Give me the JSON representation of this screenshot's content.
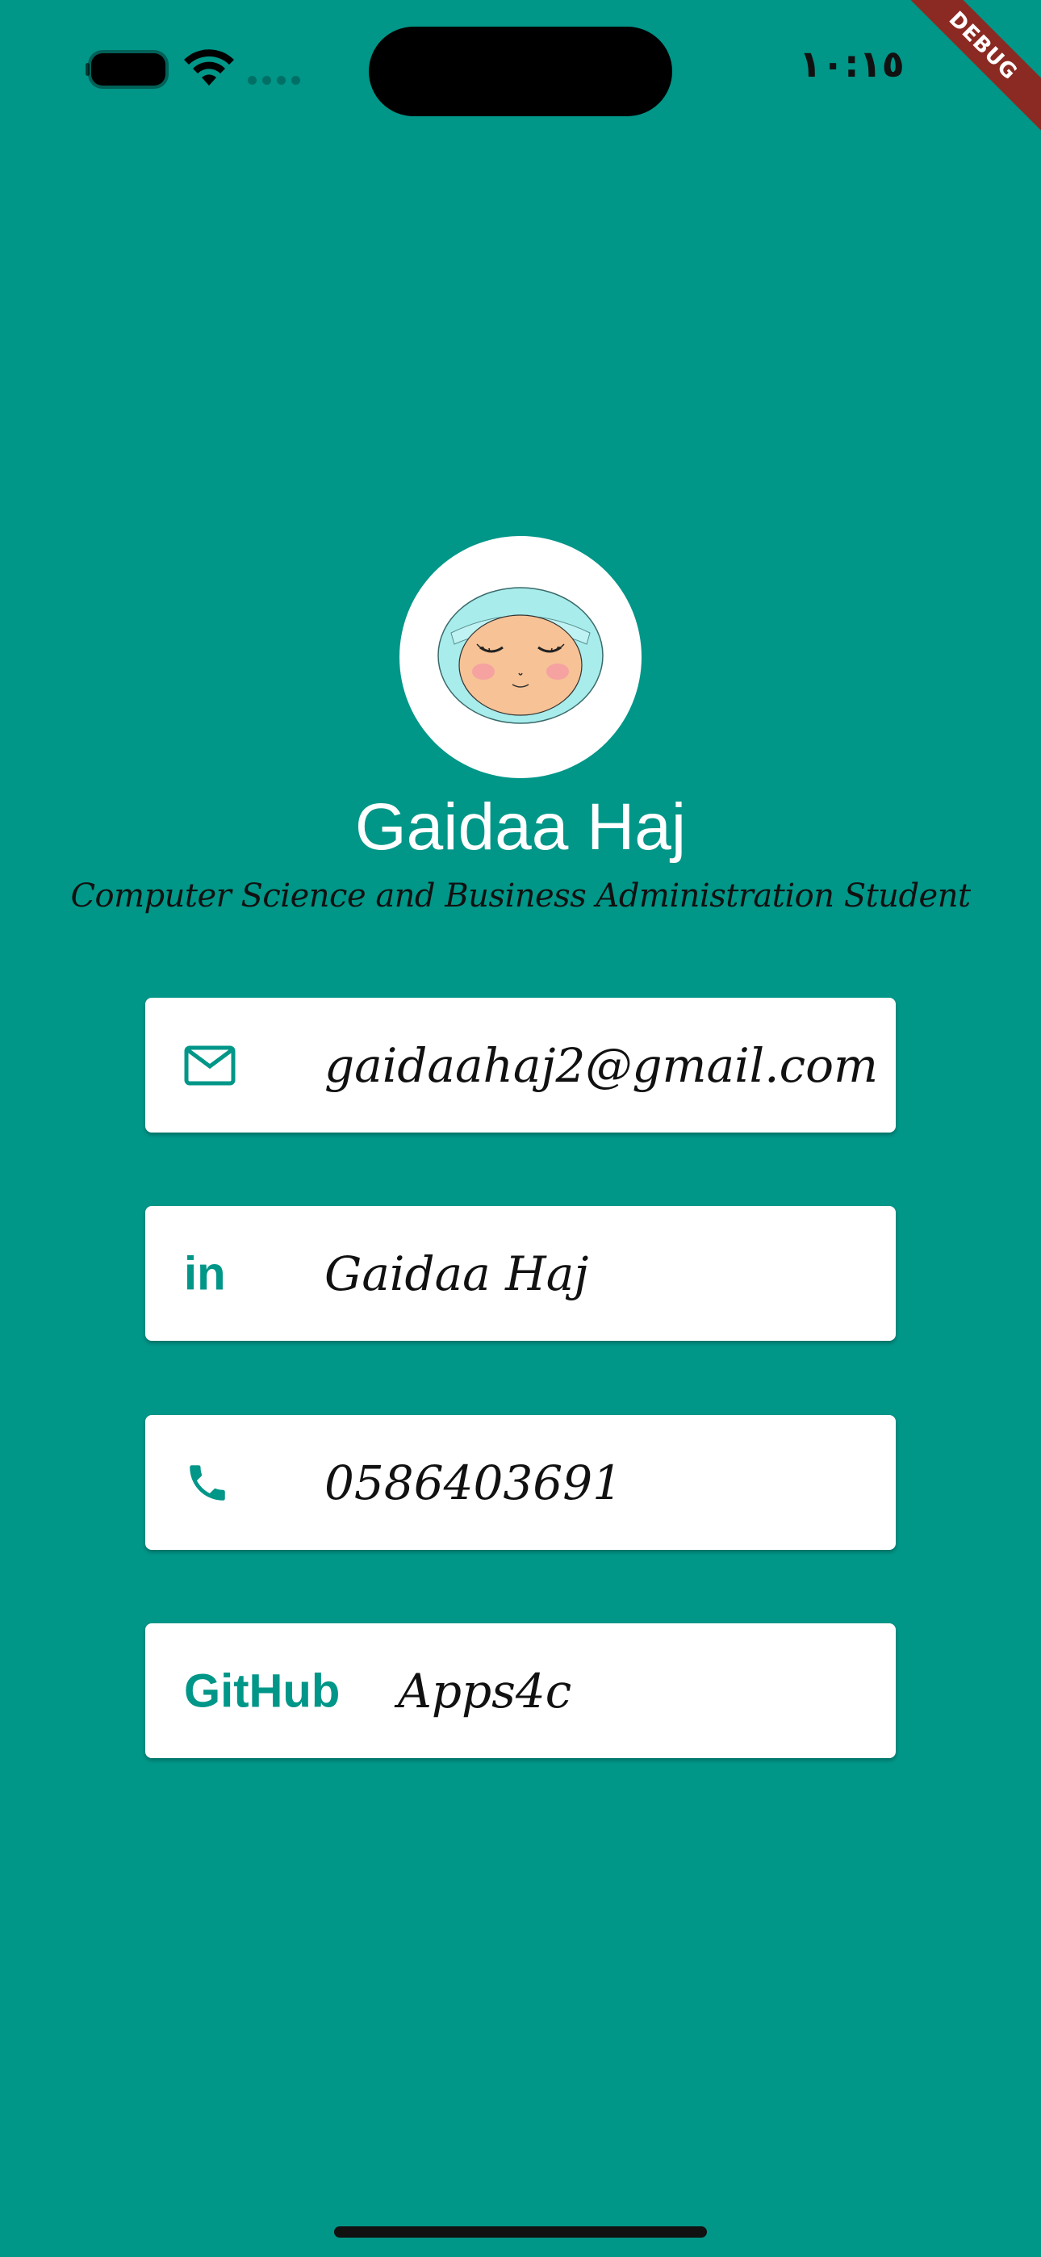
{
  "status_bar": {
    "time": "١٠:١٥",
    "icons": [
      "battery-icon",
      "wifi-icon",
      "cellular-signal-icon"
    ]
  },
  "debug_banner": "DEBUG",
  "profile": {
    "name": "Gaidaa Haj",
    "title": "Computer Science and Business Administration Student"
  },
  "contacts": [
    {
      "icon": "mail-icon",
      "text": "gaidaahaj2@gmail.com"
    },
    {
      "icon": "linkedin-icon",
      "icon_label": "in",
      "text": "Gaidaa Haj"
    },
    {
      "icon": "phone-icon",
      "text": "0586403691"
    },
    {
      "icon": "github-icon",
      "icon_label": "GitHub",
      "text": "Apps4c"
    }
  ],
  "colors": {
    "background": "#009688",
    "card": "#FFFFFF",
    "accent": "#009688",
    "debug_ribbon": "#8A2A22"
  }
}
